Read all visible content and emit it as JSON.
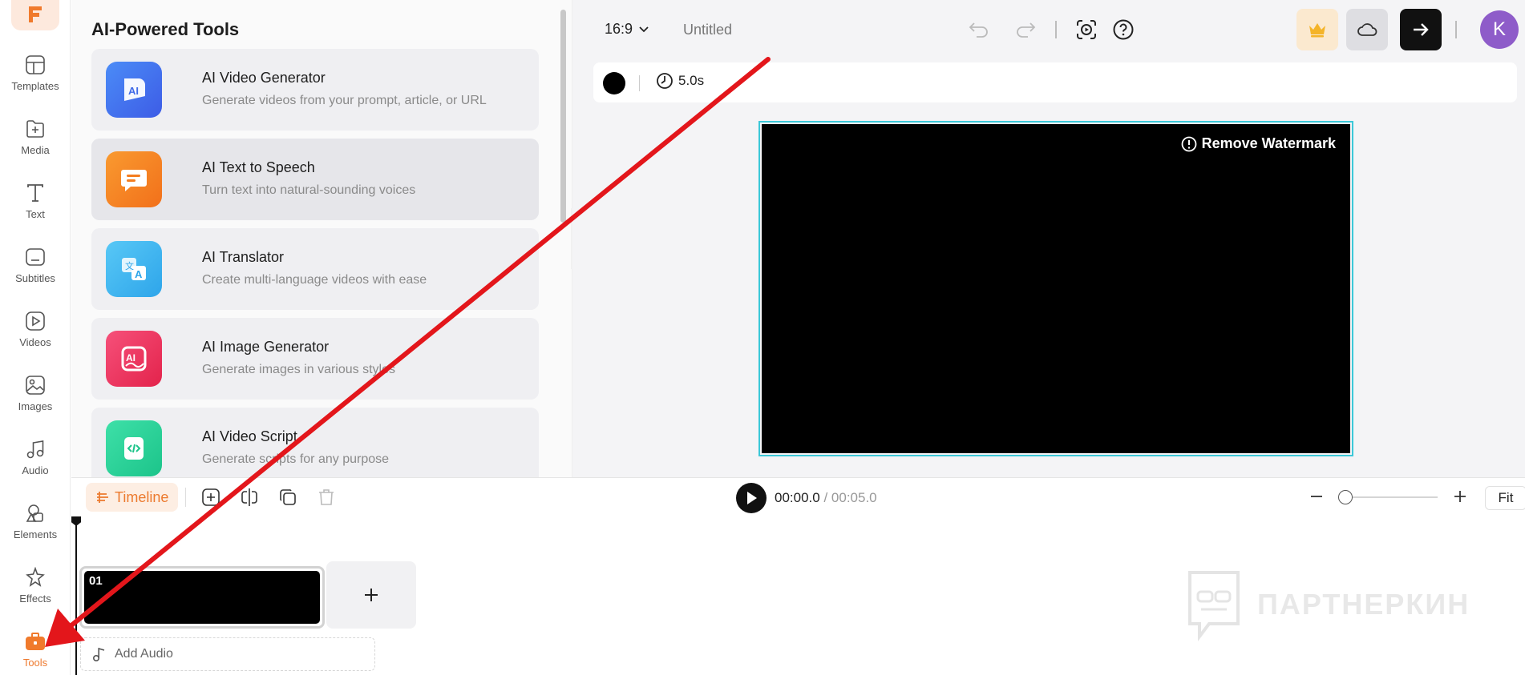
{
  "nav": {
    "items": [
      {
        "label": "Templates",
        "icon": "templates-icon"
      },
      {
        "label": "Media",
        "icon": "media-icon"
      },
      {
        "label": "Text",
        "icon": "text-icon"
      },
      {
        "label": "Subtitles",
        "icon": "subtitles-icon"
      },
      {
        "label": "Videos",
        "icon": "videos-icon"
      },
      {
        "label": "Images",
        "icon": "images-icon"
      },
      {
        "label": "Audio",
        "icon": "audio-icon"
      },
      {
        "label": "Elements",
        "icon": "elements-icon"
      },
      {
        "label": "Effects",
        "icon": "effects-icon"
      },
      {
        "label": "Tools",
        "icon": "tools-icon",
        "active": true
      }
    ]
  },
  "panel": {
    "title": "AI-Powered Tools",
    "tools": [
      {
        "title": "AI Video Generator",
        "desc": "Generate videos from your prompt, article, or URL",
        "color": "#4f7cf3"
      },
      {
        "title": "AI Text to Speech",
        "desc": "Turn text into natural-sounding voices",
        "color": "#f47d1f"
      },
      {
        "title": "AI Translator",
        "desc": "Create multi-language videos with ease",
        "color": "#3fb6ee"
      },
      {
        "title": "AI Image Generator",
        "desc": "Generate images in various styles",
        "color": "#f0385d"
      },
      {
        "title": "AI Video Script",
        "desc": "Generate scripts for any purpose",
        "color": "#2fd39a"
      }
    ]
  },
  "topbar": {
    "ratio": "16:9",
    "title": "Untitled",
    "avatar_letter": "K"
  },
  "stage": {
    "duration": "5.0s",
    "remove_watermark": "Remove Watermark"
  },
  "timeline": {
    "tab_label": "Timeline",
    "current_time": "00:00.0",
    "separator": " / ",
    "total_time": "00:05.0",
    "fit_label": "Fit",
    "clip_number": "01",
    "add_audio": "Add Audio"
  },
  "watermark_text": "ПАРТНЕРКИН",
  "colors": {
    "accent": "#ee7a2f",
    "selection": "#3cc8d8",
    "annotation_arrow": "#e3161b"
  }
}
